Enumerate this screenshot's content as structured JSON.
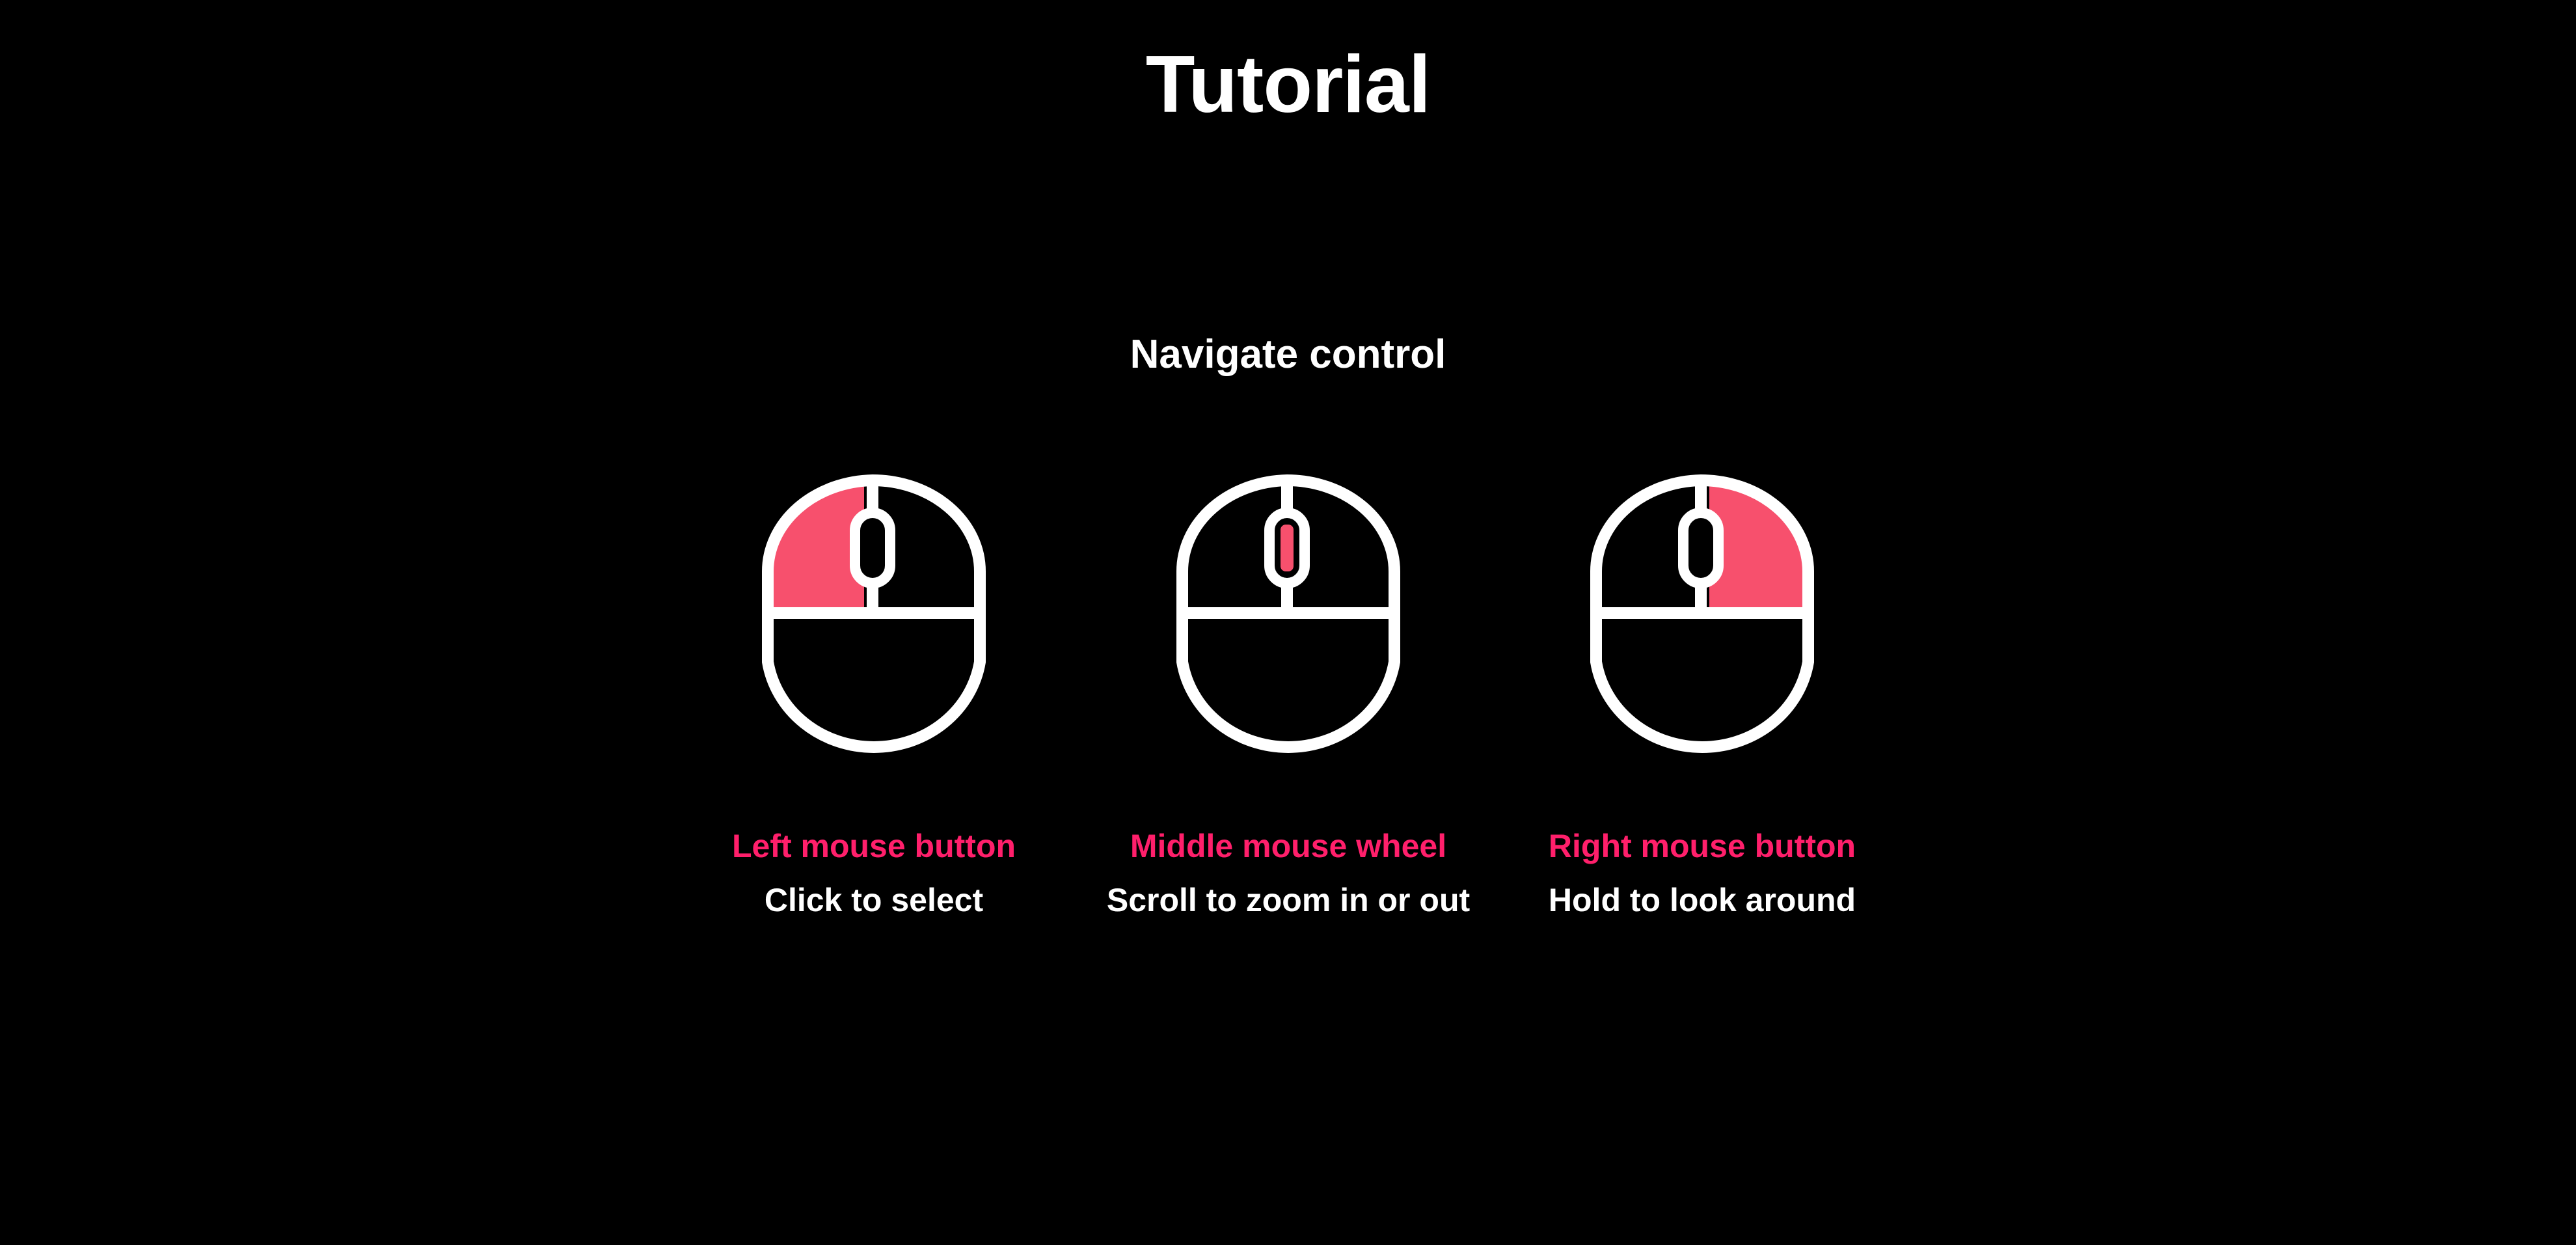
{
  "header": {
    "title": "Tutorial"
  },
  "section": {
    "title": "Navigate control"
  },
  "colors": {
    "background": "#000000",
    "text": "#ffffff",
    "accent_text": "#ff1f6b",
    "accent_fill": "#f7506d",
    "icon_stroke": "#ffffff"
  },
  "controls": [
    {
      "label": "Left mouse button",
      "description": "Click to select",
      "icon": "mouse-left-button-icon",
      "highlight": "left"
    },
    {
      "label": "Middle mouse wheel",
      "description": "Scroll to zoom in or out",
      "icon": "mouse-scroll-wheel-icon",
      "highlight": "wheel"
    },
    {
      "label": "Right mouse button",
      "description": "Hold to look around",
      "icon": "mouse-right-button-icon",
      "highlight": "right"
    }
  ]
}
